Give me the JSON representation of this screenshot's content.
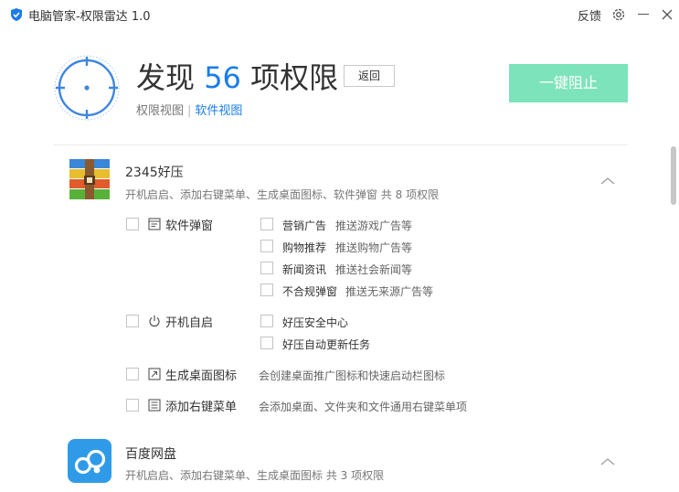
{
  "window": {
    "title": "电脑管家-权限雷达 1.0",
    "feedback_label": "反馈"
  },
  "header": {
    "title_prefix": "发现",
    "count": "56",
    "title_suffix": "项权限",
    "back_label": "返回",
    "view_permission": "权限视图",
    "view_separator": "|",
    "view_software": "软件视图",
    "block_all_label": "一键阻止",
    "accent_color": "#1a7de8",
    "block_color": "#7de3ba"
  },
  "apps": [
    {
      "name": "2345好压",
      "summary": "开机启启、添加右键菜单、生成桌面图标、软件弹窗  共 8 项权限",
      "groups": [
        {
          "icon": "popup-window-icon",
          "label": "软件弹窗",
          "items": [
            {
              "name": "营销广告",
              "desc": "推送游戏广告等"
            },
            {
              "name": "购物推荐",
              "desc": "推送购物广告等"
            },
            {
              "name": "新闻资讯",
              "desc": "推送社会新闻等"
            },
            {
              "name": "不合规弹窗",
              "desc": "推送无来源广告等"
            }
          ]
        },
        {
          "icon": "power-icon",
          "label": "开机自启",
          "items": [
            {
              "name": "好压安全中心",
              "desc": ""
            },
            {
              "name": "好压自动更新任务",
              "desc": ""
            }
          ]
        },
        {
          "icon": "desktop-shortcut-icon",
          "label": "生成桌面图标",
          "desc": "会创建桌面推广图标和快速启动栏图标"
        },
        {
          "icon": "context-menu-icon",
          "label": "添加右键菜单",
          "desc": "会添加桌面、文件夹和文件通用右键菜单项"
        }
      ]
    },
    {
      "name": "百度网盘",
      "summary": "开机启启、添加右键菜单、生成桌面图标  共 3 项权限"
    }
  ]
}
